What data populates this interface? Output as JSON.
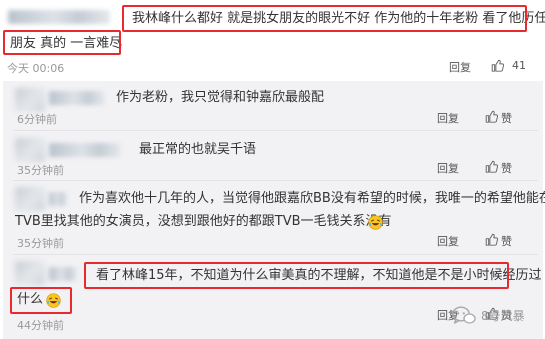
{
  "main_comment": {
    "line1": "我林峰什么都好 就是挑女朋友的眼光不好 作为他的十年老粉 看了他历任女",
    "line2": "朋友 真的 一言难尽",
    "time": "今天 00:06",
    "reply_label": "回复",
    "like_count": "41"
  },
  "replies": [
    {
      "text": "作为老粉，我只觉得和钟嘉欣最般配",
      "time": "6分钟前",
      "reply_label": "回复",
      "like_label": "赞"
    },
    {
      "text": "最正常的也就吴千语",
      "time": "35分钟前",
      "reply_label": "回复",
      "like_label": "赞"
    },
    {
      "line1": "作为喜欢他十几年的人，当觉得他跟嘉欣BB没有希望的时候，我唯一的希望他能在",
      "line2": "TVB里找其他的女演员，没想到跟他好的都跟TVB一毛钱关系没有",
      "time": "35分钟前",
      "reply_label": "回复",
      "like_label": "赞"
    },
    {
      "line1": "看了林峰15年，不知道为什么审美真的不理解，不知道他是不是小时候经历过",
      "line2": "什么",
      "time": "44分钟前",
      "reply_label": "回复",
      "like_label": "赞"
    }
  ],
  "watermark": {
    "label": "8号风暴"
  },
  "colors": {
    "highlight": "#e8292e",
    "panel": "#f2f2f5",
    "meta": "#999999",
    "text": "#333333"
  }
}
